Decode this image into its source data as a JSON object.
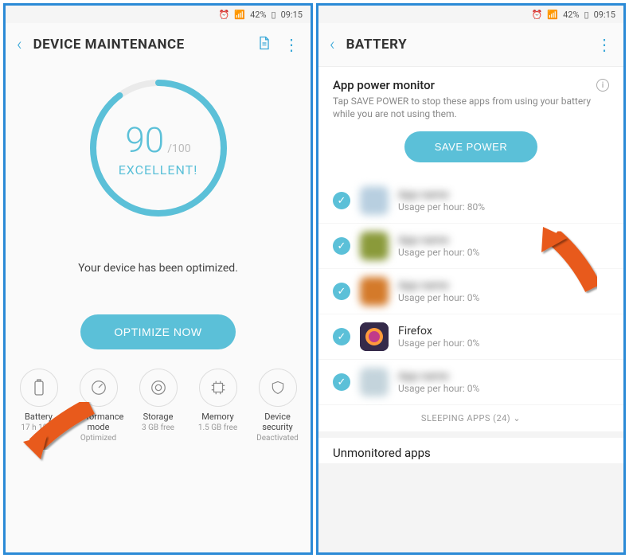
{
  "status": {
    "battery_pct": "42%",
    "time": "09:15"
  },
  "left": {
    "title": "DEVICE MAINTENANCE",
    "score": "90",
    "score_max": "/100",
    "score_label": "EXCELLENT!",
    "message": "Your device has been optimized.",
    "optimize_btn": "OPTIMIZE NOW",
    "tiles": [
      {
        "label": "Battery",
        "sub": "17 h 10 m"
      },
      {
        "label": "Performance mode",
        "sub": "Optimized"
      },
      {
        "label": "Storage",
        "sub": "3 GB free"
      },
      {
        "label": "Memory",
        "sub": "1.5 GB free"
      },
      {
        "label": "Device security",
        "sub": "Deactivated"
      }
    ]
  },
  "right": {
    "title": "BATTERY",
    "section_title": "App power monitor",
    "section_desc": "Tap SAVE POWER to stop these apps from using your battery while you are not using them.",
    "save_btn": "SAVE POWER",
    "apps": [
      {
        "name": "",
        "usage": "Usage per hour: 80%",
        "blur": true,
        "color": "#b8cfe0"
      },
      {
        "name": "",
        "usage": "Usage per hour: 0%",
        "blur": true,
        "color": "#8a9a3a"
      },
      {
        "name": "",
        "usage": "Usage per hour: 0%",
        "blur": true,
        "color": "#d47a2a"
      },
      {
        "name": "Firefox",
        "usage": "Usage per hour: 0%",
        "blur": false,
        "color": "#3a2a5a"
      },
      {
        "name": "",
        "usage": "Usage per hour: 0%",
        "blur": true,
        "color": "#c4d4dc"
      }
    ],
    "sleeping": "SLEEPING APPS (24)",
    "unmonitored": "Unmonitored apps"
  }
}
